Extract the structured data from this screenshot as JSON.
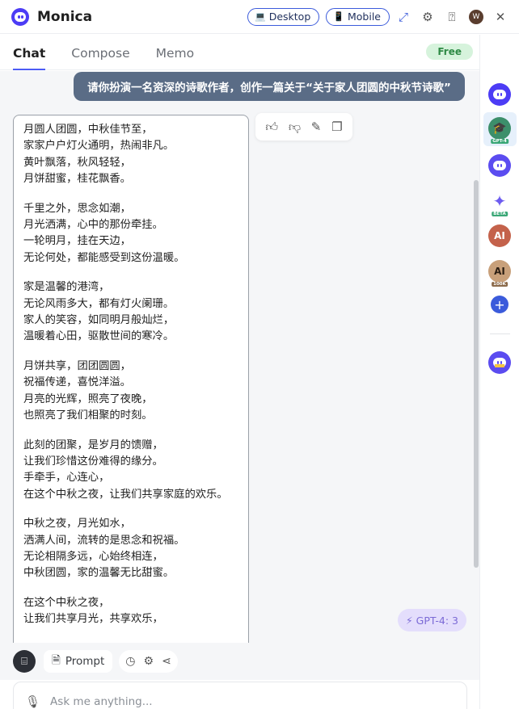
{
  "header": {
    "app_title": "Monica",
    "desktop_label": "Desktop",
    "mobile_label": "Mobile",
    "avatar_initial": "W"
  },
  "tabs": [
    {
      "label": "Chat",
      "active": true
    },
    {
      "label": "Compose",
      "active": false
    },
    {
      "label": "Memo",
      "active": false
    }
  ],
  "plan_badge": "Free",
  "chat": {
    "user_message": "请你扮演一名资深的诗歌作者，创作一篇关于“关于家人团圆的中秋节诗歌”",
    "poem_stanzas": [
      [
        "月圆人团圆，中秋佳节至，",
        "家家户户灯火通明，热闹非凡。",
        "黄叶飘落，秋风轻轻，",
        "月饼甜蜜，桂花飘香。"
      ],
      [
        "千里之外，思念如潮，",
        "月光洒满，心中的那份牵挂。",
        "一轮明月，挂在天边，",
        "无论何处，都能感受到这份温暖。"
      ],
      [
        "家是温馨的港湾，",
        "无论风雨多大，都有灯火阑珊。",
        "家人的笑容，如同明月般灿烂，",
        "温暖着心田，驱散世间的寒冷。"
      ],
      [
        "月饼共享，团团圆圆，",
        "祝福传递，喜悦洋溢。",
        "月亮的光辉，照亮了夜晚，",
        "也照亮了我们相聚的时刻。"
      ],
      [
        "此刻的团聚，是岁月的馈赠，",
        "让我们珍惜这份难得的缘分。",
        "手牵手，心连心，",
        "在这个中秋之夜，让我们共享家庭的欢乐。"
      ],
      [
        "中秋之夜，月光如水，",
        "洒满人间，流转的是思念和祝福。",
        "无论相隔多远，心始终相连，",
        "中秋团圆，家的温馨无比甜蜜。"
      ],
      [
        "在这个中秋之夜，",
        "让我们共享月光，共享欢乐，"
      ]
    ],
    "model_badge": "GPT-4: 3"
  },
  "sidebar": {
    "items": [
      {
        "name": "monica",
        "tag": ""
      },
      {
        "name": "gpt-4",
        "tag": "GPT-4"
      },
      {
        "name": "monica-alt",
        "tag": ""
      },
      {
        "name": "gemini",
        "tag": "BETA"
      },
      {
        "name": "claude",
        "tag": ""
      },
      {
        "name": "claude-100k",
        "tag": "100K"
      },
      {
        "name": "add",
        "tag": ""
      },
      {
        "name": "invite",
        "tag": ""
      }
    ]
  },
  "toolbar": {
    "prompt_label": "Prompt"
  },
  "input": {
    "placeholder": "Ask me anything...",
    "value": ""
  },
  "colors": {
    "accent": "#4c3cf5",
    "user_bubble": "#5a6c86",
    "free_badge_bg": "#d6f3dc",
    "gpt_badge_bg": "#e4defc"
  }
}
